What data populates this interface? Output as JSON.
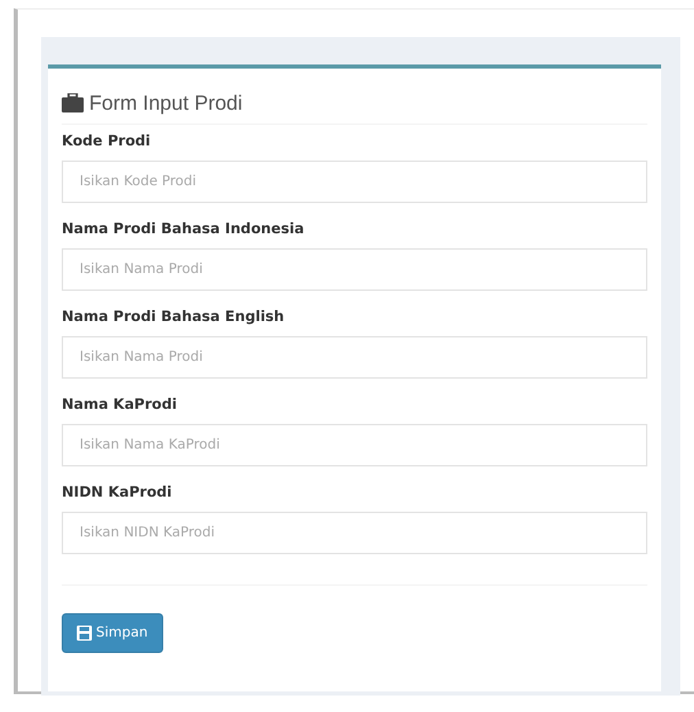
{
  "panel": {
    "title": "Form Input Prodi"
  },
  "fields": [
    {
      "label": "Kode Prodi",
      "placeholder": "Isikan Kode Prodi"
    },
    {
      "label": "Nama Prodi Bahasa Indonesia",
      "placeholder": "Isikan Nama Prodi"
    },
    {
      "label": "Nama Prodi Bahasa English",
      "placeholder": "Isikan Nama Prodi"
    },
    {
      "label": "Nama KaProdi",
      "placeholder": "Isikan Nama KaProdi"
    },
    {
      "label": "NIDN KaProdi",
      "placeholder": "Isikan NIDN KaProdi"
    }
  ],
  "buttons": [
    "Simpan"
  ]
}
